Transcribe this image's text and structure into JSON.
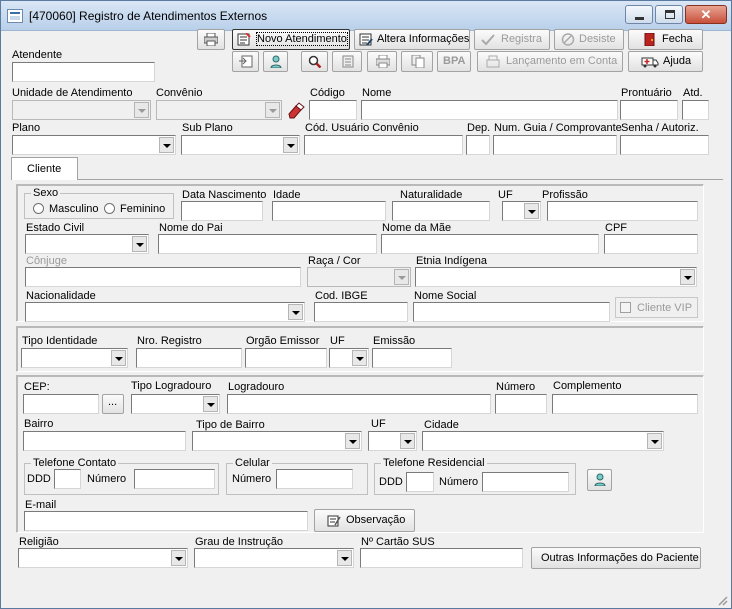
{
  "window": {
    "title": "[470060]  Registro de Atendimentos Externos"
  },
  "toolbar": {
    "novo_atendimento": "Novo Atendimento",
    "altera_informacoes": "Altera Informações",
    "registra": "Registra",
    "desiste": "Desiste",
    "fecha": "Fecha",
    "bpa": "BPA",
    "lancamento_em_conta": "Lançamento em Conta",
    "ajuda": "Ajuda"
  },
  "header": {
    "atendente_label": "Atendente",
    "unidade_label": "Unidade de Atendimento",
    "convenio_label": "Convênio",
    "codigo_label": "Código",
    "nome_label": "Nome",
    "prontuario_label": "Prontuário",
    "atd_label": "Atd.",
    "plano_label": "Plano",
    "sub_plano_label": "Sub Plano",
    "cod_usuario_label": "Cód. Usuário Convênio",
    "dep_label": "Dep.",
    "num_guia_label": "Num. Guia / Comprovante",
    "senha_label": "Senha / Autoriz."
  },
  "tabs": {
    "cliente": "Cliente"
  },
  "personal": {
    "sexo_label": "Sexo",
    "masculino": "Masculino",
    "feminino": "Feminino",
    "data_nascimento": "Data Nascimento",
    "idade": "Idade",
    "naturalidade": "Naturalidade",
    "uf": "UF",
    "profissao": "Profissão",
    "estado_civil": "Estado Civil",
    "nome_pai": "Nome do Pai",
    "nome_mae": "Nome da Mãe",
    "cpf": "CPF",
    "conjuge": "Cônjuge",
    "raca_cor": "Raça / Cor",
    "etnia": "Etnia Indígena",
    "nacionalidade": "Nacionalidade",
    "cod_ibge": "Cod. IBGE",
    "nome_social": "Nome Social",
    "cliente_vip": "Cliente VIP"
  },
  "identity": {
    "tipo_identidade": "Tipo Identidade",
    "nro_registro": "Nro. Registro",
    "orgao_emissor": "Orgão Emissor",
    "uf": "UF",
    "emissao": "Emissão"
  },
  "address": {
    "cep": "CEP:",
    "cep_button": "...",
    "tipo_logradouro": "Tipo Logradouro",
    "logradouro": "Logradouro",
    "numero": "Número",
    "complemento": "Complemento",
    "bairro": "Bairro",
    "tipo_bairro": "Tipo de Bairro",
    "uf": "UF",
    "cidade": "Cidade",
    "telefone_contato": "Telefone Contato",
    "celular": "Celular",
    "telefone_residencial": "Telefone Residencial",
    "ddd": "DDD",
    "numero_tel": "Número",
    "email": "E-mail",
    "observacao": "Observação"
  },
  "footer": {
    "religiao": "Religião",
    "grau_instrucao": "Grau de Instrução",
    "cartao_sus": "Nº Cartão SUS",
    "outras_informacoes": "Outras Informações do Paciente"
  },
  "colors": {
    "window_bg": "#f0f0f0",
    "titlebar": "#c9dbef",
    "close_button": "#c7503a"
  }
}
